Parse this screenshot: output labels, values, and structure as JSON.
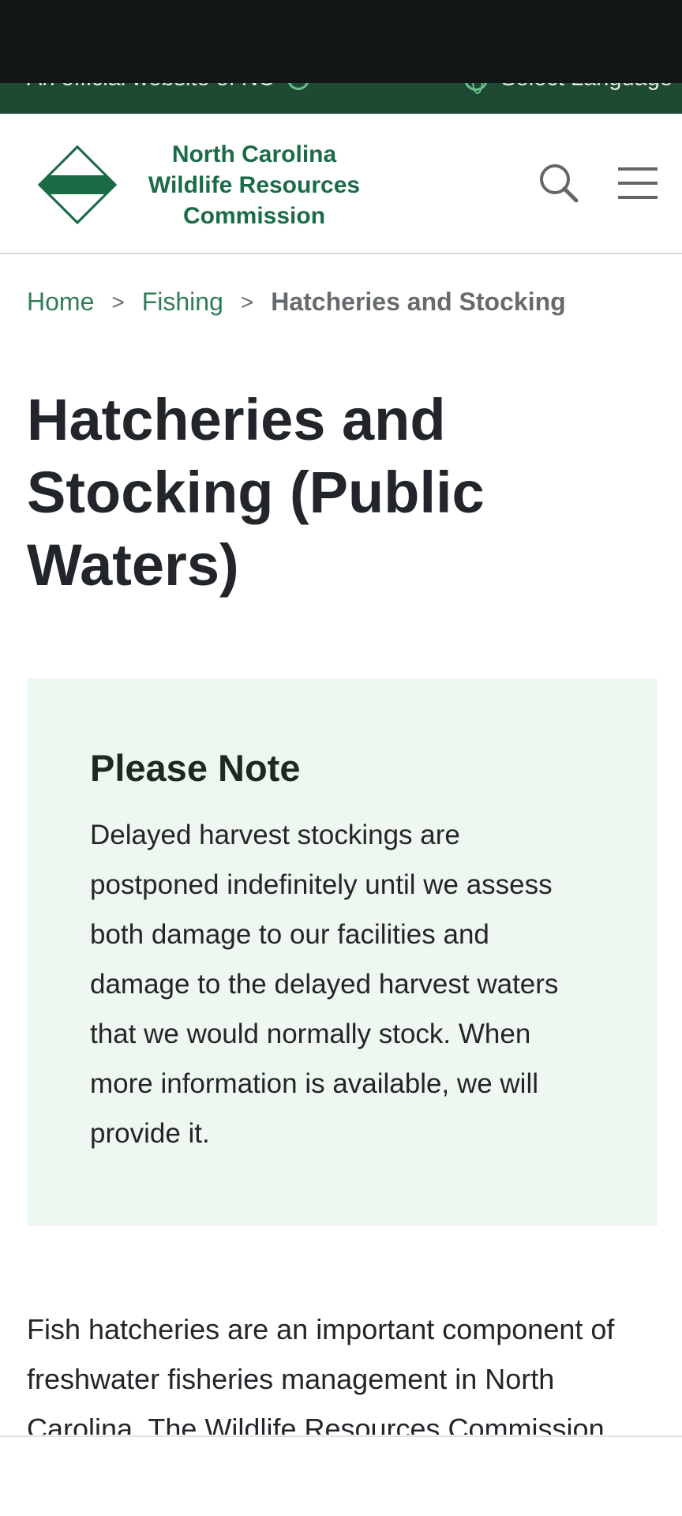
{
  "official_strip": {
    "left_text": "An official website of NC",
    "right_text": "Select Language"
  },
  "header": {
    "logo_lines": [
      "North Carolina",
      "Wildlife Resources",
      "Commission"
    ],
    "search_icon": "search-icon",
    "menu_icon": "hamburger-menu-icon"
  },
  "breadcrumb": {
    "items": [
      "Home",
      "Fishing"
    ],
    "separator": ">",
    "current": "Hatcheries and Stocking"
  },
  "page": {
    "title": "Hatcheries and Stocking (Public Waters)"
  },
  "note": {
    "title": "Please Note",
    "body": "Delayed harvest stockings are postponed indefinitely until we assess both damage to our facilities and damage to the delayed harvest waters that we would normally stock. When more information is available, we will provide it."
  },
  "intro": {
    "text": "Fish hatcheries are an important component of freshwater fisheries management in North Carolina. The Wildlife Resources Commission uses"
  },
  "colors": {
    "brand_green": "#1a6b46",
    "strip_green": "#1e4a33",
    "note_background": "#eff8f0",
    "link_green": "#2f7d55"
  }
}
